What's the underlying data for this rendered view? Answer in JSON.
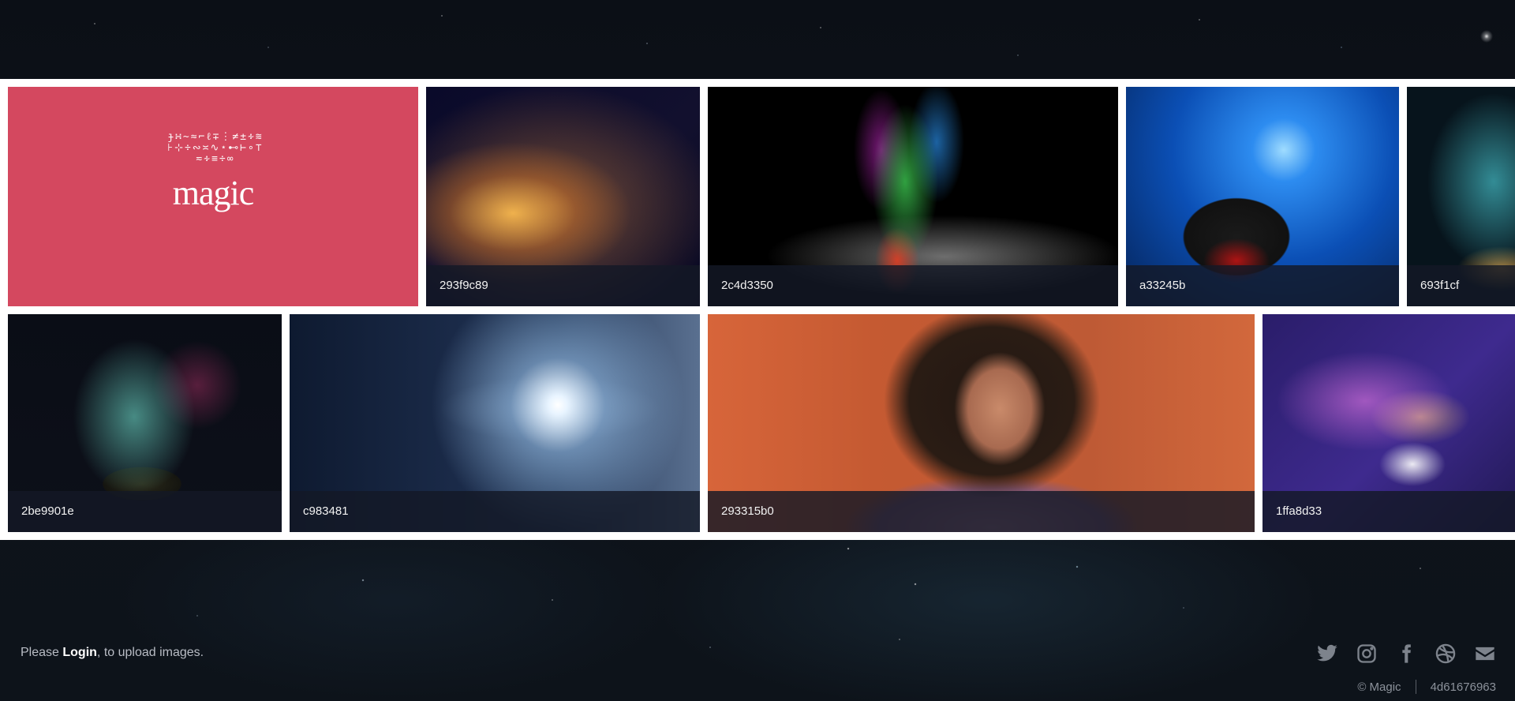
{
  "gallery": {
    "tiles": [
      {
        "caption": ""
      },
      {
        "caption": "293f9c89"
      },
      {
        "caption": "2c4d3350"
      },
      {
        "caption": "a33245b"
      },
      {
        "caption": "693f1cf"
      },
      {
        "caption": "2be9901e"
      },
      {
        "caption": "c983481"
      },
      {
        "caption": "293315b0"
      },
      {
        "caption": "1ffa8d33"
      }
    ],
    "logo_text": "magic",
    "logo_glyphs": "ɟ∺~≈⌐ℓ∓⋮≠±∻≋⊦⊹÷∾≍∿⋆⊷⊢∘⊤≂∻≡÷∞"
  },
  "footer": {
    "login_prefix": "Please ",
    "login_link": "Login",
    "login_suffix": ", to upload images.",
    "social_icons": [
      "twitter-icon",
      "instagram-icon",
      "facebook-icon",
      "dribbble-icon",
      "mail-icon"
    ],
    "copyright": "© Magic",
    "build_id": "4d61676963"
  }
}
